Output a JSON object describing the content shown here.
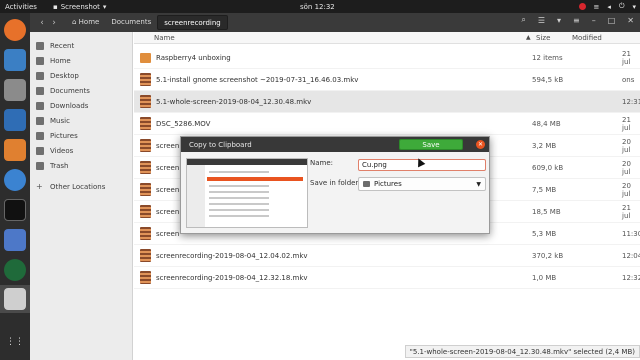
{
  "topbar": {
    "activities": "Activities",
    "app_name": "Screenshot",
    "clock": "sön 12:32"
  },
  "headerbar": {
    "breadcrumbs": [
      "Home",
      "Documents",
      "screenrecording"
    ]
  },
  "sidebar": {
    "items": [
      "Recent",
      "Home",
      "Desktop",
      "Documents",
      "Downloads",
      "Music",
      "Pictures",
      "Videos",
      "Trash"
    ],
    "other": "Other Locations"
  },
  "list": {
    "col_name": "Name",
    "col_size": "Size",
    "col_modified": "Modified",
    "rows": [
      {
        "name": "Raspberry4 unboxing",
        "size": "12 items",
        "modified": "21 jul",
        "kind": "folder"
      },
      {
        "name": "5.1-install gnome screenshot ~2019-07-31_16.46.03.mkv",
        "size": "594,5 kB",
        "modified": "ons",
        "kind": "video"
      },
      {
        "name": "5.1-whole-screen-2019-08-04_12.30.48.mkv",
        "size": "",
        "modified": "12:31",
        "kind": "video",
        "selected": true
      },
      {
        "name": "DSC_5286.MOV",
        "size": "48,4 MB",
        "modified": "21 jul",
        "kind": "video"
      },
      {
        "name": "screen",
        "size": "3,2 MB",
        "modified": "20 jul",
        "kind": "video"
      },
      {
        "name": "screen",
        "size": "609,0 kB",
        "modified": "20 jul",
        "kind": "video"
      },
      {
        "name": "screen",
        "size": "7,5 MB",
        "modified": "20 jul",
        "kind": "video"
      },
      {
        "name": "screen",
        "size": "18,5 MB",
        "modified": "21 jul",
        "kind": "video"
      },
      {
        "name": "screen",
        "size": "5,3 MB",
        "modified": "11:30",
        "kind": "video"
      },
      {
        "name": "screenrecording-2019-08-04_12.04.02.mkv",
        "size": "370,2 kB",
        "modified": "12:04",
        "kind": "video"
      },
      {
        "name": "screenrecording-2019-08-04_12.32.18.mkv",
        "size": "1,0 MB",
        "modified": "12:32",
        "kind": "video"
      }
    ]
  },
  "statusbar": {
    "text": "\"5.1-whole-screen-2019-08-04_12.30.48.mkv\" selected (2,4 MB)"
  },
  "dialog": {
    "title": "Copy to Clipboard",
    "save_label": "Save",
    "name_label": "Name:",
    "name_value": "Cu.png",
    "folder_label": "Save in folder:",
    "folder_value": "Pictures"
  },
  "colors": {
    "accent": "#e95420",
    "save_green": "#3eaa3a"
  }
}
